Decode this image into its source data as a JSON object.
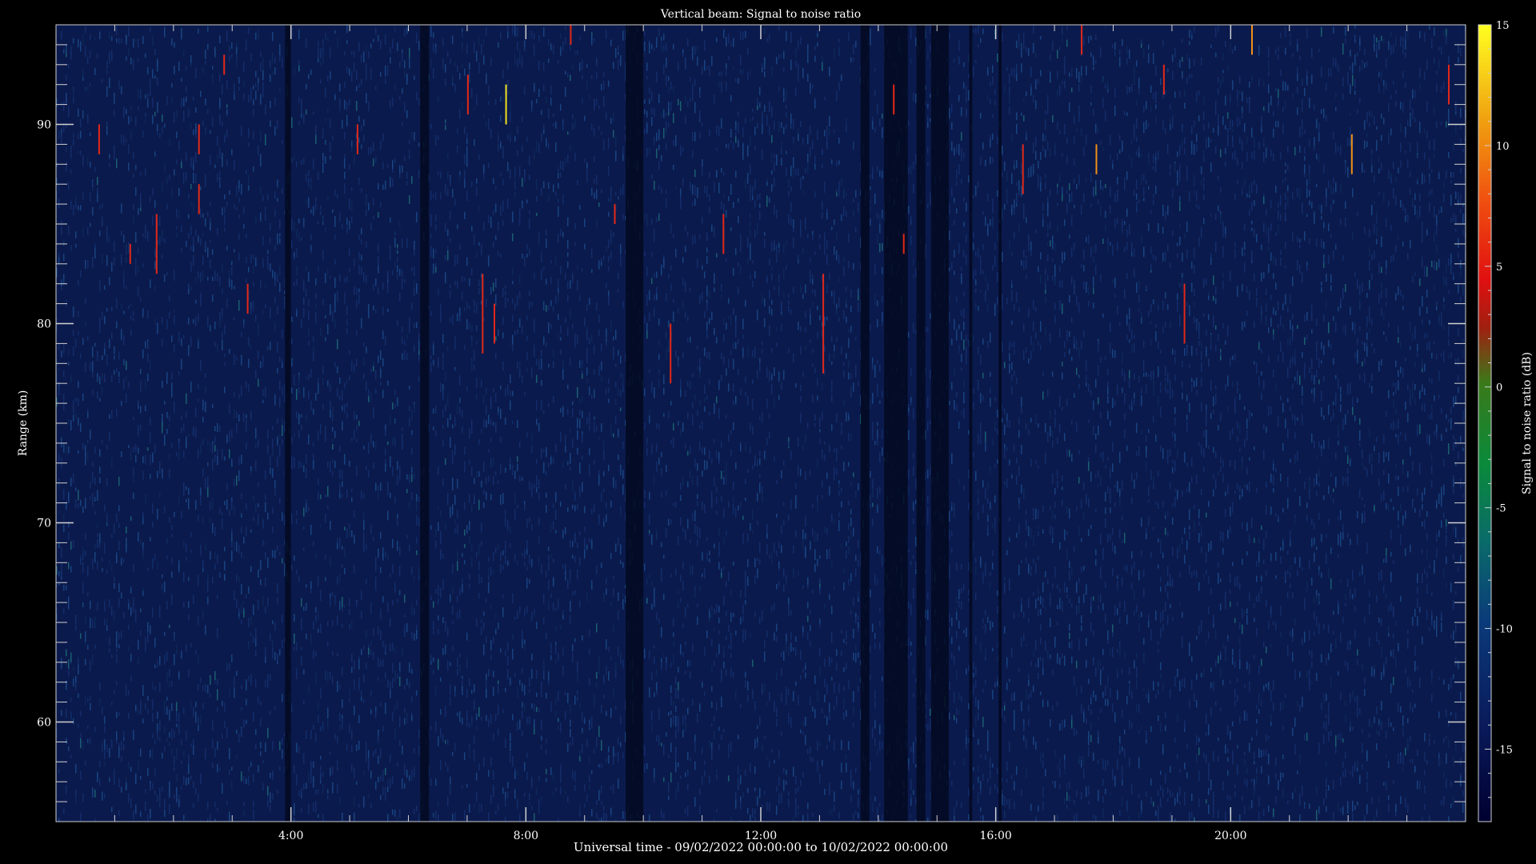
{
  "chart_data": {
    "type": "heatmap",
    "title": "Vertical beam: Signal to noise ratio",
    "xlabel": "Universal time - 09/02/2022 00:00:00 to 10/02/2022 00:00:00",
    "ylabel": "Range (km)",
    "colorbar_label": "Signal to noise ratio (dB)",
    "x_range_hours": [
      0,
      24
    ],
    "x_ticks": [
      "4:00",
      "8:00",
      "12:00",
      "16:00",
      "20:00"
    ],
    "x_tick_hours": [
      4,
      8,
      12,
      16,
      20
    ],
    "y_range_km": [
      55,
      95
    ],
    "y_ticks": [
      60,
      70,
      80,
      90
    ],
    "colorbar_range_db": [
      -18,
      15
    ],
    "colorbar_ticks": [
      15,
      10,
      5,
      0,
      -5,
      -10,
      -15
    ],
    "background_level_db": -15,
    "dark_bands_hours": [
      [
        3.9,
        4.0
      ],
      [
        6.2,
        6.35
      ],
      [
        9.7,
        10.0
      ],
      [
        13.7,
        13.85
      ],
      [
        14.1,
        14.5
      ],
      [
        14.65,
        14.8
      ],
      [
        14.9,
        15.2
      ],
      [
        15.55,
        15.6
      ],
      [
        16.05,
        16.1
      ]
    ],
    "meteor_echoes": [
      {
        "hour": 0.72,
        "range_km": [
          88.5,
          90
        ],
        "snr_db": 3
      },
      {
        "hour": 1.25,
        "range_km": [
          83,
          84
        ],
        "snr_db": 3
      },
      {
        "hour": 1.7,
        "range_km": [
          82.5,
          85.5
        ],
        "snr_db": 3
      },
      {
        "hour": 2.42,
        "range_km": [
          88.5,
          90
        ],
        "snr_db": 3
      },
      {
        "hour": 2.42,
        "range_km": [
          85.5,
          87
        ],
        "snr_db": 3
      },
      {
        "hour": 2.85,
        "range_km": [
          92.5,
          93.5
        ],
        "snr_db": 3
      },
      {
        "hour": 3.25,
        "range_km": [
          80.5,
          82
        ],
        "snr_db": 3
      },
      {
        "hour": 5.12,
        "range_km": [
          88.5,
          90
        ],
        "snr_db": 3
      },
      {
        "hour": 7.0,
        "range_km": [
          90.5,
          92.5
        ],
        "snr_db": 5
      },
      {
        "hour": 7.25,
        "range_km": [
          78.5,
          82.5
        ],
        "snr_db": 3
      },
      {
        "hour": 7.45,
        "range_km": [
          79,
          81
        ],
        "snr_db": 3
      },
      {
        "hour": 7.65,
        "range_km": [
          90,
          92
        ],
        "snr_db": 12
      },
      {
        "hour": 8.75,
        "range_km": [
          94,
          95
        ],
        "snr_db": 3
      },
      {
        "hour": 9.5,
        "range_km": [
          85,
          86
        ],
        "snr_db": 3
      },
      {
        "hour": 10.45,
        "range_km": [
          77,
          80
        ],
        "snr_db": 3
      },
      {
        "hour": 11.35,
        "range_km": [
          83.5,
          85.5
        ],
        "snr_db": 3
      },
      {
        "hour": 13.05,
        "range_km": [
          77.5,
          82.5
        ],
        "snr_db": 3
      },
      {
        "hour": 14.25,
        "range_km": [
          90.5,
          92
        ],
        "snr_db": 3
      },
      {
        "hour": 14.42,
        "range_km": [
          83.5,
          84.5
        ],
        "snr_db": 3
      },
      {
        "hour": 16.45,
        "range_km": [
          86.5,
          89
        ],
        "snr_db": 3
      },
      {
        "hour": 17.45,
        "range_km": [
          93.5,
          95
        ],
        "snr_db": 3
      },
      {
        "hour": 17.7,
        "range_km": [
          87.5,
          89
        ],
        "snr_db": 8
      },
      {
        "hour": 18.85,
        "range_km": [
          91.5,
          93
        ],
        "snr_db": 3
      },
      {
        "hour": 19.2,
        "range_km": [
          79,
          82
        ],
        "snr_db": 3
      },
      {
        "hour": 20.35,
        "range_km": [
          93.5,
          95
        ],
        "snr_db": 8
      },
      {
        "hour": 22.05,
        "range_km": [
          87.5,
          89.5
        ],
        "snr_db": 8
      },
      {
        "hour": 23.7,
        "range_km": [
          91,
          93
        ],
        "snr_db": 5
      }
    ]
  }
}
